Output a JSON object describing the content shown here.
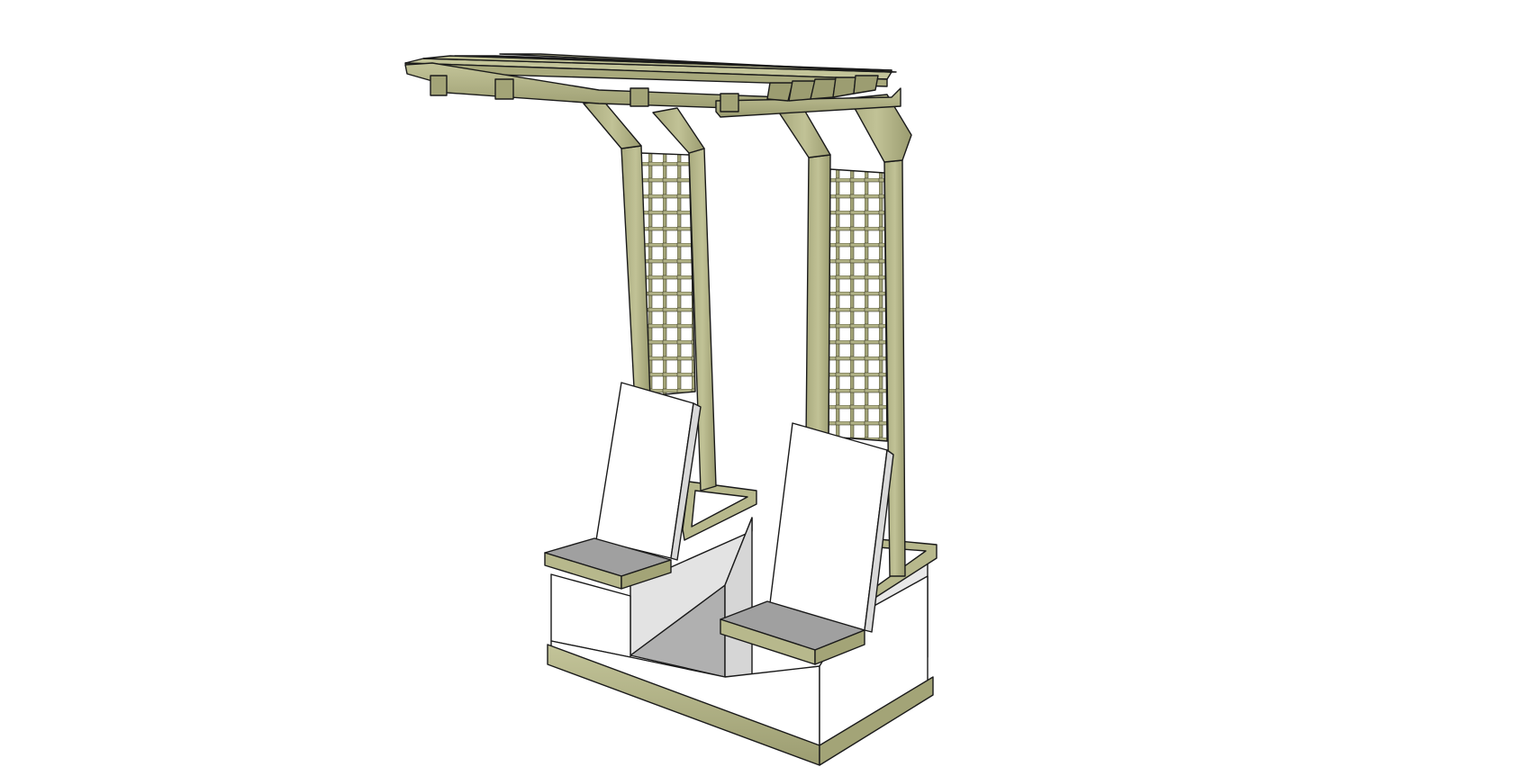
{
  "scene": {
    "subject": "pergola-with-two-planter-chairs",
    "colors": {
      "background": "#ffffff",
      "wood_light": "#b7b88c",
      "wood_mid": "#a3a477",
      "wood_dark": "#8a8b62",
      "planter_white": "#ffffff",
      "planter_shade": "#dcdcdc",
      "seat_top": "#a0a0a0",
      "outline": "#1a1a1a"
    }
  }
}
